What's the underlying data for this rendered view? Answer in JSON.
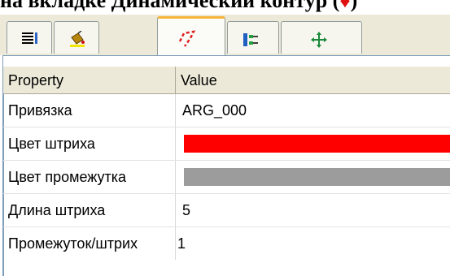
{
  "document_line": {
    "text": "на вкладке Динамический контур (",
    "suffix": ")"
  },
  "tabs": [
    {
      "name": "properties-tab",
      "icon": "list-icon",
      "active": false
    },
    {
      "name": "fill-tab",
      "icon": "paint-bucket-icon",
      "active": false
    },
    {
      "name": "dynamic-contour-tab",
      "icon": "dashed-contour-icon",
      "active": true
    },
    {
      "name": "connect-tab",
      "icon": "connector-icon",
      "active": false
    },
    {
      "name": "move-tab",
      "icon": "move-arrows-icon",
      "active": false
    }
  ],
  "grid": {
    "header": {
      "property": "Property",
      "value": "Value"
    },
    "rows": [
      {
        "label": "Привязка",
        "value": "ARG_000"
      },
      {
        "label": "Цвет штриха",
        "color": "#ff0000"
      },
      {
        "label": "Цвет промежутка",
        "color": "#9c9c9c"
      },
      {
        "label": "Длина штриха",
        "value": "5"
      },
      {
        "label": "Промежуток/штрих",
        "value": "1"
      }
    ]
  },
  "colors": {
    "accent_tab": "#f7b43a",
    "border": "#7f9db9",
    "tab_strip": "#ece9d8"
  }
}
